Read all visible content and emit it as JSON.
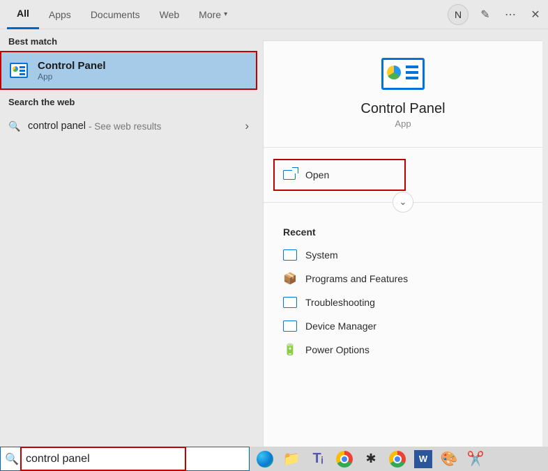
{
  "header": {
    "tabs": [
      "All",
      "Apps",
      "Documents",
      "Web",
      "More"
    ],
    "active_tab": 0,
    "avatar_initial": "N"
  },
  "left": {
    "best_match_label": "Best match",
    "best_match": {
      "title": "Control Panel",
      "subtitle": "App"
    },
    "web_label": "Search the web",
    "web_result": {
      "query": "control panel",
      "suffix": "- See web results"
    }
  },
  "right": {
    "title": "Control Panel",
    "subtitle": "App",
    "open_label": "Open",
    "recent_label": "Recent",
    "recent_items": [
      {
        "label": "System",
        "icon": "cp"
      },
      {
        "label": "Programs and Features",
        "icon": "box"
      },
      {
        "label": "Troubleshooting",
        "icon": "cp"
      },
      {
        "label": "Device Manager",
        "icon": "cp"
      },
      {
        "label": "Power Options",
        "icon": "power"
      }
    ]
  },
  "search_value": "control panel",
  "annotations": {
    "best_match_highlighted": true,
    "open_highlighted": true,
    "search_highlighted": true
  }
}
